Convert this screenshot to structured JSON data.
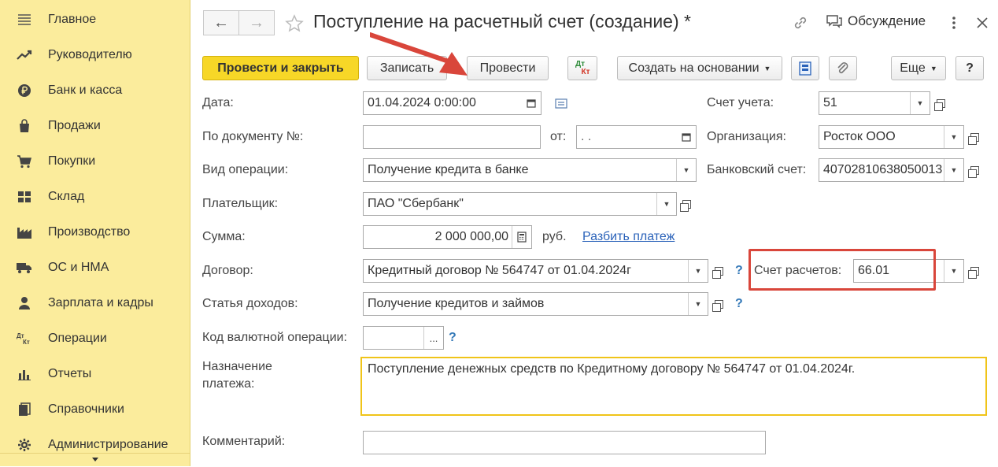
{
  "sidebar": {
    "items": [
      {
        "label": "Главное",
        "icon": "menu-icon"
      },
      {
        "label": "Руководителю",
        "icon": "trend-icon"
      },
      {
        "label": "Банк и касса",
        "icon": "ruble-coin-icon"
      },
      {
        "label": "Продажи",
        "icon": "shopping-bag-icon"
      },
      {
        "label": "Покупки",
        "icon": "cart-icon"
      },
      {
        "label": "Склад",
        "icon": "warehouse-icon"
      },
      {
        "label": "Производство",
        "icon": "factory-icon"
      },
      {
        "label": "ОС и НМА",
        "icon": "truck-icon"
      },
      {
        "label": "Зарплата и кадры",
        "icon": "person-icon"
      },
      {
        "label": "Операции",
        "icon": "dt-kt-icon"
      },
      {
        "label": "Отчеты",
        "icon": "bar-chart-icon"
      },
      {
        "label": "Справочники",
        "icon": "books-icon"
      },
      {
        "label": "Администрирование",
        "icon": "gear-icon"
      }
    ],
    "dt_icon_text": "Дт",
    "kt_icon_text": "Кт"
  },
  "header": {
    "title": "Поступление на расчетный счет (создание) *",
    "back_icon": "←",
    "forward_icon": "→",
    "discussion_label": "Обсуждение"
  },
  "toolbar": {
    "post_close": "Провести и закрыть",
    "save": "Записать",
    "post": "Провести",
    "dtkt_dt": "Дт",
    "dtkt_kt": "Кт",
    "create_based": "Создать на основании",
    "more": "Еще",
    "help": "?"
  },
  "form": {
    "date_label": "Дата:",
    "date_value": "01.04.2024  0:00:00",
    "doc_number_label": "По документу №:",
    "doc_number_value": "",
    "from_label": "от:",
    "from_value": " .  .",
    "operation_label": "Вид операции:",
    "operation_value": "Получение кредита в банке",
    "payer_label": "Плательщик:",
    "payer_value": "ПАО \"Сбербанк\"",
    "amount_label": "Сумма:",
    "amount_value": "2 000 000,00",
    "currency": "руб.",
    "split_link": "Разбить платеж",
    "contract_label": "Договор:",
    "contract_value": "Кредитный договор № 564747 от 01.04.2024г",
    "income_label": "Статья доходов:",
    "income_value": "Получение кредитов и займов",
    "currency_op_label": "Код валютной операции:",
    "currency_op_value": "",
    "purpose_label_1": "Назначение",
    "purpose_label_2": "платежа:",
    "purpose_value": "Поступление денежных средств по Кредитному договору № 564747 от 01.04.2024г.",
    "comment_label": "Комментарий:",
    "comment_value": "",
    "account_label": "Счет учета:",
    "account_value": "51",
    "org_label": "Организация:",
    "org_value": "Росток ООО",
    "bank_account_label": "Банковский счет:",
    "bank_account_value": "40702810638050013",
    "settlement_label": "Счет расчетов:",
    "settlement_value": "66.01",
    "help_mark": "?"
  },
  "colors": {
    "sidebar_bg": "#fbec9c",
    "primary_button": "#f7d727",
    "annotation_red": "#d9463b",
    "highlight_border": "#f0c419"
  }
}
